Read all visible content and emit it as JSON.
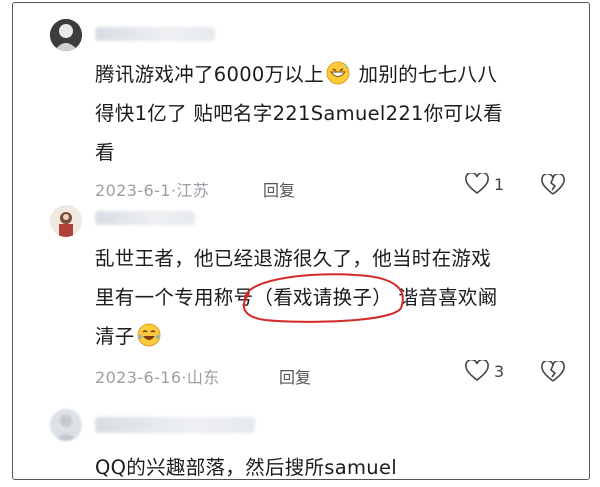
{
  "comments": [
    {
      "text_lines": [
        "腾讯游戏冲了6000万以上",
        "加别的七七八八",
        "得快1亿了 贴吧名字221Samuel221你可以看",
        "看"
      ],
      "emoji": "grinning-sweat-emoji",
      "date": "2023-6-1",
      "location": "江苏",
      "reply_label": "回复",
      "likes": "1"
    },
    {
      "text_lines": [
        "乱世王者，他已经退游很久了，他当时在游戏",
        "里有一个专用称号",
        "（看戏请换子）",
        "谐音喜欢阚",
        "清子"
      ],
      "emoji": "crying-laughing-emoji",
      "date": "2023-6-16",
      "location": "山东",
      "reply_label": "回复",
      "likes": "3"
    },
    {
      "text_lines": [
        "QQ的兴趣部落，然后搜所samuel"
      ]
    }
  ],
  "colors": {
    "annotation_circle": "#d42a2a",
    "meta_text": "#9aa0a6"
  }
}
